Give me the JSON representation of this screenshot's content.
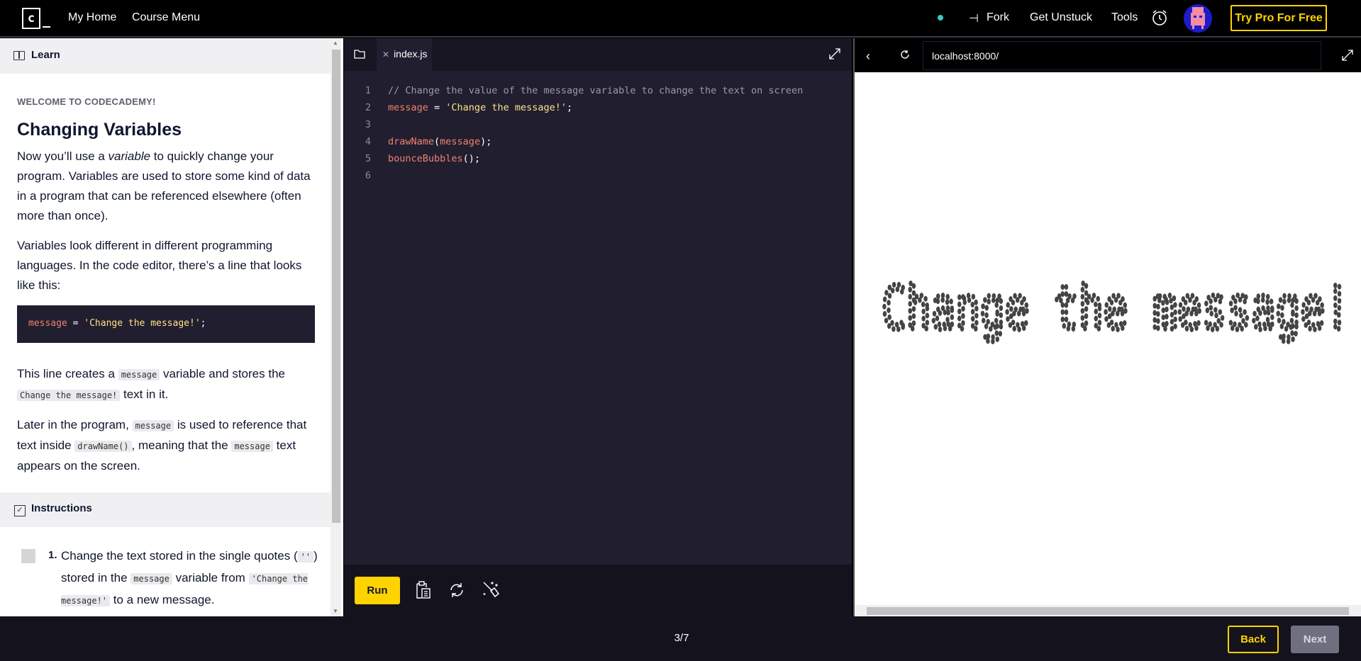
{
  "header": {
    "logo_text": "c",
    "nav": [
      "My Home",
      "Course Menu"
    ],
    "fork_label": "Fork",
    "get_unstuck_label": "Get Unstuck",
    "tools_label": "Tools",
    "try_pro_label": "Try Pro For Free",
    "status_dot_color": "#3cc8c8",
    "accent_color": "#ffd300"
  },
  "learn": {
    "header_label": "Learn",
    "eyebrow": "WELCOME TO CODECADEMY!",
    "title": "Changing Variables",
    "p1_a": "Now you’ll use a ",
    "p1_em": "variable",
    "p1_b": " to quickly change your program. Variables are used to store some kind of data in a program that can be referenced elsewhere (often more than once).",
    "p2": "Variables look different in different programming languages. In the code editor, there’s a line that looks like this:",
    "code_var": "message",
    "code_eq": " = ",
    "code_str": "'Change the message!'",
    "code_semi": ";",
    "p3_a": "This line creates a ",
    "p3_code1": "message",
    "p3_b": " variable and stores the ",
    "p3_code2": "Change the message!",
    "p3_c": " text in it.",
    "p4_a": "Later in the program, ",
    "p4_code1": "message",
    "p4_b": " is used to reference that text inside ",
    "p4_code2": "drawName()",
    "p4_c": ", meaning that the ",
    "p4_code3": "message",
    "p4_d": " text appears on the screen."
  },
  "instructions": {
    "header_label": "Instructions",
    "steps": [
      {
        "number": "1.",
        "a": "Change the text stored in the single quotes (",
        "code1": "''",
        "b": ") stored in the ",
        "code2": "message",
        "c": " variable from ",
        "code3": "'Change the message!'",
        "d": " to a new message."
      }
    ]
  },
  "editor": {
    "tab_label": "index.js",
    "run_label": "Run",
    "line_numbers": [
      "1",
      "2",
      "3",
      "4",
      "5",
      "6"
    ],
    "line1_comment": "// Change the value of the message variable to change the text on screen",
    "line2_var": "message",
    "line2_eq": " = ",
    "line2_str": "'Change the message!'",
    "line2_semi": ";",
    "line4_fn": "drawName",
    "line4_open": "(",
    "line4_arg": "message",
    "line4_close": ");",
    "line5_fn": "bounceBubbles",
    "line5_rest": "();"
  },
  "browser": {
    "url": "localhost:8000/",
    "rendered_text": "Change the message!"
  },
  "footer": {
    "progress": "3/7",
    "back_label": "Back",
    "next_label": "Next"
  }
}
